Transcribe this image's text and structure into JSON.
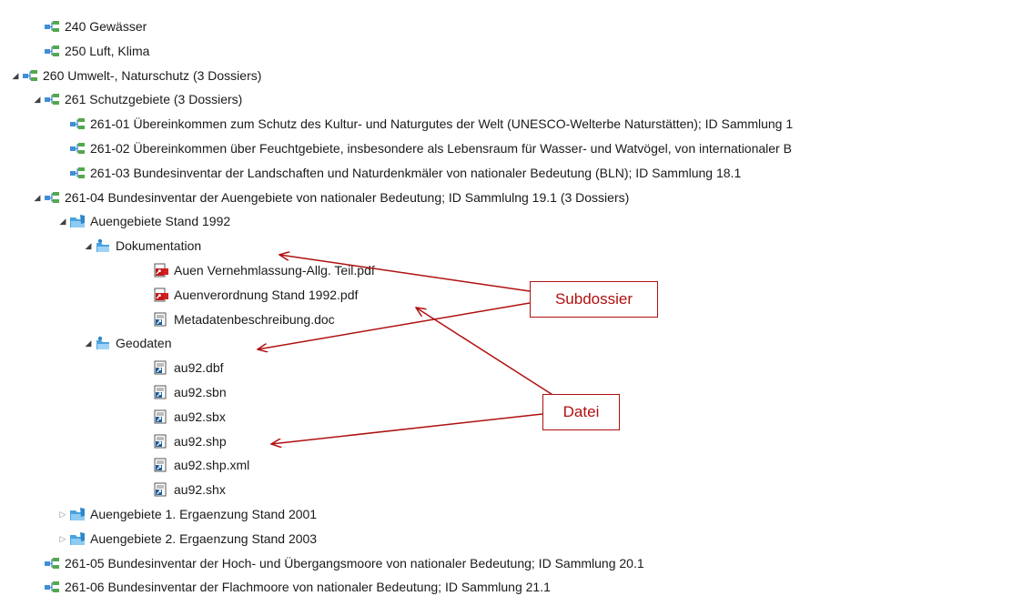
{
  "tree": [
    {
      "label": "240 Gewässer",
      "icon": "classification-icon",
      "toggle": "none"
    },
    {
      "label": "250 Luft, Klima",
      "icon": "classification-icon",
      "toggle": "none"
    },
    {
      "label": "260 Umwelt-, Naturschutz (3 Dossiers)",
      "icon": "classification-icon",
      "toggle": "expanded"
    },
    {
      "label": "261 Schutzgebiete (3 Dossiers)",
      "icon": "classification-icon",
      "toggle": "expanded"
    },
    {
      "label": "261-01 Übereinkommen zum Schutz des Kultur- und Naturgutes der Welt (UNESCO-Welterbe Naturstätten); ID Sammlung 1",
      "icon": "classification-icon",
      "toggle": "none"
    },
    {
      "label": "261-02 Übereinkommen über Feuchtgebiete, insbesondere als Lebensraum für Wasser- und Watvögel, von internationaler B",
      "icon": "classification-icon",
      "toggle": "none"
    },
    {
      "label": "261-03 Bundesinventar der Landschaften und Naturdenkmäler von nationaler Bedeutung (BLN); ID Sammlung 18.1",
      "icon": "classification-icon",
      "toggle": "none"
    },
    {
      "label": "261-04 Bundesinventar der Auengebiete von nationaler Bedeutung; ID Sammlulng 19.1 (3 Dossiers)",
      "icon": "classification-icon",
      "toggle": "expanded"
    },
    {
      "label": "Auengebiete Stand 1992",
      "icon": "dossier-folder-icon",
      "toggle": "expanded"
    },
    {
      "label": "Dokumentation",
      "icon": "subdossier-folder-icon",
      "toggle": "expanded"
    },
    {
      "label": "Auen Vernehmlassung-Allg. Teil.pdf",
      "icon": "pdf-file-icon",
      "toggle": "none"
    },
    {
      "label": "Auenverordnung Stand 1992.pdf",
      "icon": "pdf-file-icon",
      "toggle": "none"
    },
    {
      "label": "Metadatenbeschreibung.doc",
      "icon": "file-icon",
      "toggle": "none"
    },
    {
      "label": "Geodaten",
      "icon": "subdossier-folder-icon",
      "toggle": "expanded"
    },
    {
      "label": "au92.dbf",
      "icon": "file-icon",
      "toggle": "none"
    },
    {
      "label": "au92.sbn",
      "icon": "file-icon",
      "toggle": "none"
    },
    {
      "label": "au92.sbx",
      "icon": "file-icon",
      "toggle": "none"
    },
    {
      "label": "au92.shp",
      "icon": "file-icon",
      "toggle": "none"
    },
    {
      "label": "au92.shp.xml",
      "icon": "file-icon",
      "toggle": "none"
    },
    {
      "label": "au92.shx",
      "icon": "file-icon",
      "toggle": "none"
    },
    {
      "label": "Auengebiete 1. Ergaenzung Stand 2001",
      "icon": "dossier-folder-icon",
      "toggle": "collapsed"
    },
    {
      "label": "Auengebiete 2. Ergaenzung Stand 2003",
      "icon": "dossier-folder-icon",
      "toggle": "collapsed"
    },
    {
      "label": "261-05 Bundesinventar der Hoch- und Übergangsmoore von nationaler Bedeutung; ID Sammlung 20.1",
      "icon": "classification-icon",
      "toggle": "none"
    },
    {
      "label": "261-06 Bundesinventar der Flachmoore von nationaler Bedeutung; ID Sammlung 21.1",
      "icon": "classification-icon",
      "toggle": "none"
    }
  ],
  "callouts": {
    "subdossier": "Subdossier",
    "datei": "Datei"
  },
  "colors": {
    "annotation": "#b01010",
    "folder": "#4aa3e0"
  }
}
